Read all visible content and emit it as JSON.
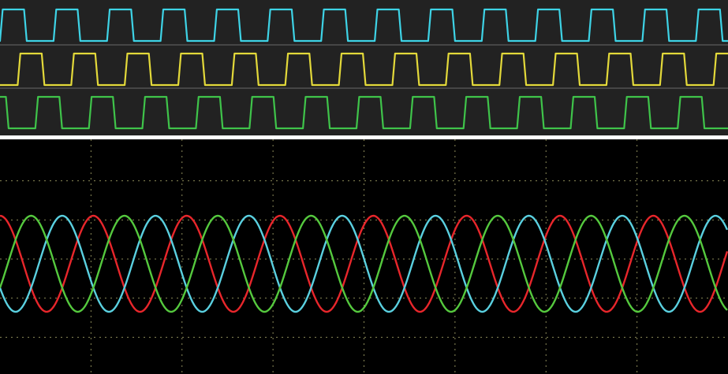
{
  "chart_data": [
    {
      "type": "line",
      "panel": "top",
      "background": "#222222",
      "lane_separator_color": "#6a6a6a",
      "x_range_cycles": [
        0,
        14
      ],
      "series": [
        {
          "color": "#3ed3e6",
          "cycles": 13.6,
          "phase_cycles": 0.0,
          "duty": 0.45,
          "edge": 0.05
        },
        {
          "color": "#e3d93a",
          "cycles": 13.6,
          "phase_cycles": 0.33,
          "duty": 0.45,
          "edge": 0.05
        },
        {
          "color": "#3fc44a",
          "cycles": 13.6,
          "phase_cycles": 0.66,
          "duty": 0.45,
          "edge": 0.05
        }
      ]
    },
    {
      "type": "line",
      "panel": "bottom",
      "background": "#000000",
      "grid": true,
      "grid_color": "#8c8a5a",
      "grid_divisions": {
        "x": 8,
        "y": 6
      },
      "y_range": [
        -1.6,
        1.6
      ],
      "x_range_cycles": [
        0,
        7.8
      ],
      "series": [
        {
          "color": "#e8262b",
          "amplitude": 1,
          "phase_deg": 0
        },
        {
          "color": "#5ad0e0",
          "amplitude": 1,
          "phase_deg": 120
        },
        {
          "color": "#55c93e",
          "amplitude": 1,
          "phase_deg": 240
        }
      ]
    }
  ]
}
